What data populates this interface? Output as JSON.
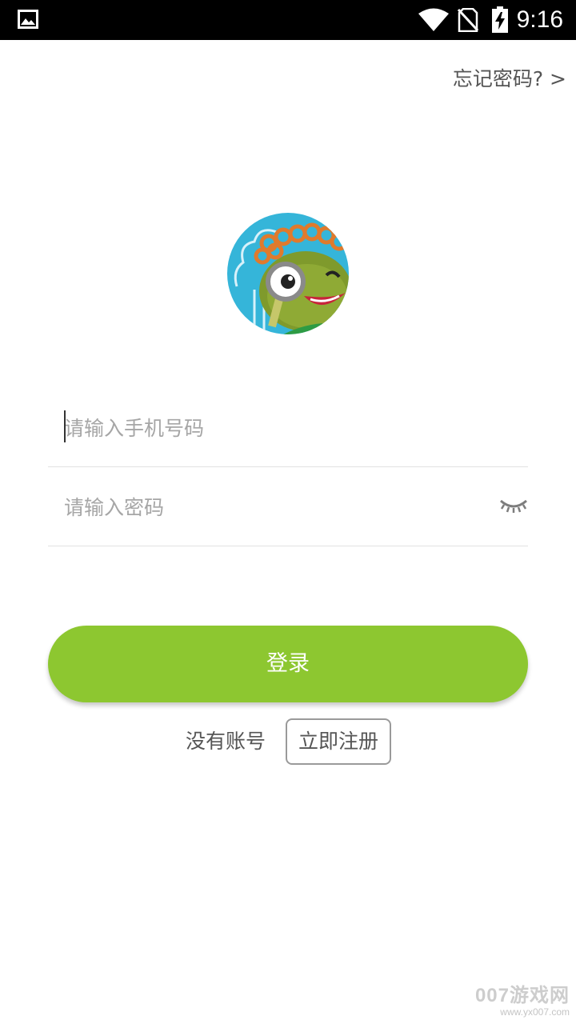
{
  "status_bar": {
    "time": "9:16",
    "icons": [
      "gallery-icon",
      "wifi-icon",
      "no-sim-icon",
      "battery-charging-icon"
    ]
  },
  "forgot_password": {
    "label": "忘记密码? >"
  },
  "avatar": {
    "description_icon": "frog-detective-avatar"
  },
  "phone_input": {
    "placeholder": "请输入手机号码",
    "value": ""
  },
  "password_input": {
    "placeholder": "请输入密码",
    "value": "",
    "toggle_icon": "eye-closed-icon"
  },
  "login_button": {
    "label": "登录",
    "color": "#8dc730"
  },
  "register": {
    "prompt": "没有账号",
    "button_label": "立即注册"
  },
  "watermark": {
    "main": "007游戏网",
    "url": "www.yx007.com"
  }
}
